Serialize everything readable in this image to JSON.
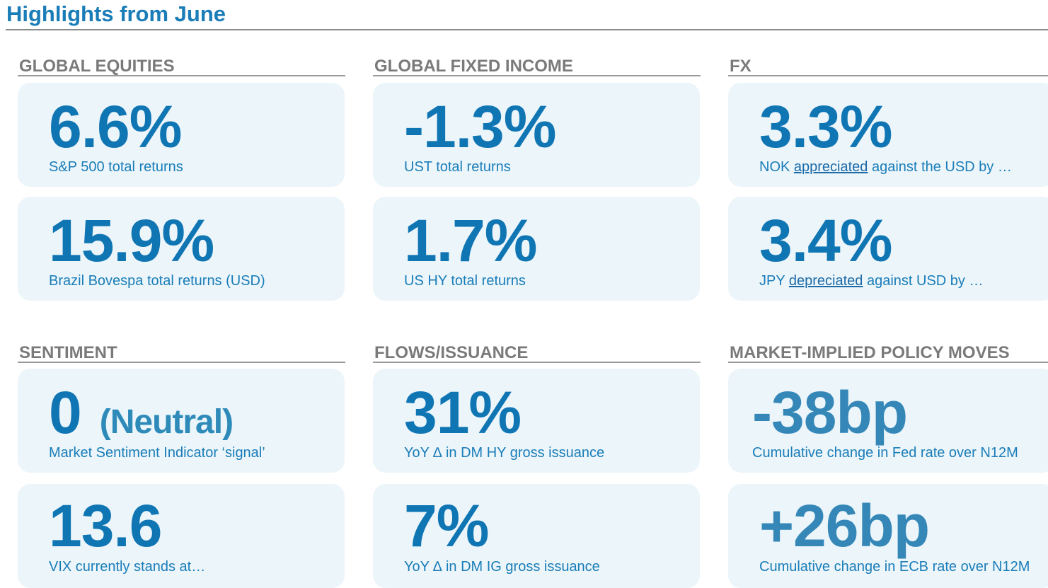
{
  "page": {
    "title": "Highlights from June"
  },
  "colors": {
    "accent": "#1a7db8",
    "accent_deep": "#0f75b3",
    "accent_muted": "#3587b8",
    "section_label": "#7a7a7a",
    "card_background": "#ebf5fa"
  },
  "sections": {
    "global_equities": {
      "label": "GLOBAL EQUITIES",
      "cards": [
        {
          "value": "6.6%",
          "caption": "S&P 500 total returns"
        },
        {
          "value": "15.9%",
          "caption": "Brazil Bovespa total returns (USD)"
        }
      ]
    },
    "global_fixed_income": {
      "label": "GLOBAL FIXED INCOME",
      "cards": [
        {
          "value": "-1.3%",
          "caption": "UST total returns"
        },
        {
          "value": "1.7%",
          "caption": "US HY total returns"
        }
      ]
    },
    "fx": {
      "label": "FX",
      "cards": [
        {
          "value": "3.3%",
          "caption_prefix": "NOK ",
          "caption_link": "appreciated",
          "caption_suffix": " against the USD by …"
        },
        {
          "value": "3.4%",
          "caption_prefix": "JPY ",
          "caption_link": "depreciated",
          "caption_suffix": " against USD by …"
        }
      ]
    },
    "sentiment": {
      "label": "SENTIMENT",
      "cards": [
        {
          "value": "0",
          "value_note": "(Neutral)",
          "caption": "Market Sentiment Indicator ‘signal’"
        },
        {
          "value": "13.6",
          "caption": "VIX currently stands at…"
        }
      ]
    },
    "flows_issuance": {
      "label": "FLOWS/ISSUANCE",
      "cards": [
        {
          "value": "31%",
          "caption": "YoY ∆ in DM HY gross issuance"
        },
        {
          "value": "7%",
          "caption": "YoY ∆ in DM IG gross issuance"
        }
      ]
    },
    "policy_moves": {
      "label": "MARKET-IMPLIED POLICY MOVES",
      "cards": [
        {
          "value": "-38bp",
          "caption": "Cumulative change in Fed rate over N12M"
        },
        {
          "value": "+26bp",
          "caption": "Cumulative change in ECB rate over N12M"
        }
      ]
    }
  }
}
